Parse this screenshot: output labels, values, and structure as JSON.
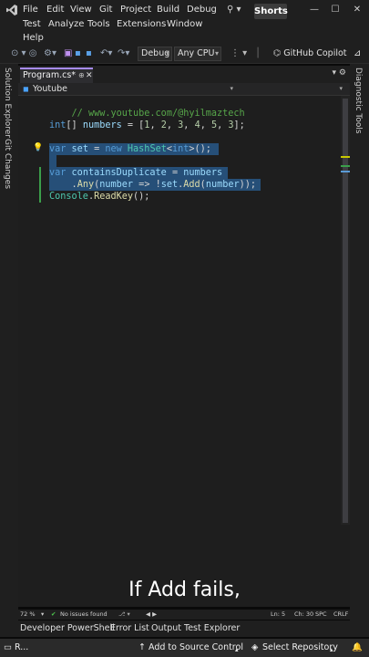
{
  "menubar": {
    "row1": [
      "File",
      "Edit",
      "View",
      "Git",
      "Project",
      "Build",
      "Debug"
    ],
    "row2": [
      "Test",
      "Analyze",
      "Tools",
      "Extensions",
      "Window"
    ],
    "row3": [
      "Help"
    ],
    "search_icon": "search-icon",
    "shorts_label": "Shorts"
  },
  "toolbar": {
    "config": "Debug",
    "platform": "Any CPU",
    "copilot_label": "GitHub Copilot"
  },
  "left_rail": {
    "solution_explorer": "Solution Explorer",
    "git_changes": "Git Changes"
  },
  "right_rail": {
    "diagnostic_tools": "Diagnostic Tools"
  },
  "tabs": {
    "active_label": "Program.cs*"
  },
  "navbar": {
    "project": "Youtube"
  },
  "code": {
    "line1": "// www.youtube.com/@hyilmaztech",
    "line2_kw": "int",
    "line2_a": "[] ",
    "line2_var": "numbers",
    "line2_b": " = [",
    "line2_n1": "1",
    "line2_n2": "2",
    "line2_n3": "3",
    "line2_n4": "4",
    "line2_n5": "5",
    "line2_n6": "3",
    "line2_end": "];",
    "line3_var": "var",
    "line3_name": "set",
    "line3_eq": " = ",
    "line3_new": "new",
    "line3_type": "HashSet",
    "line3_gen_open": "<",
    "line3_int": "int",
    "line3_gen_close": ">();",
    "line4_var": "var",
    "line4_name": "containsDuplicate",
    "line4_eq": " = ",
    "line4_src": "numbers",
    "line5_dot": ".",
    "line5_any": "Any",
    "line5_p": "(",
    "line5_arg": "number",
    "line5_arrow": " => !",
    "line5_set": "set",
    "line5_dot2": ".",
    "line5_add": "Add",
    "line5_p2": "(",
    "line5_arg2": "number",
    "line5_end": "));",
    "line6_cls": "Console",
    "line6_dot": ".",
    "line6_meth": "ReadKey",
    "line6_end": "();"
  },
  "caption": "If Add fails,",
  "status_row": {
    "zoom": "72 %",
    "issues": "No issues found",
    "ln": "Ln: 5",
    "ch": "Ch: 30",
    "spc": "SPC",
    "crlf": "CRLF"
  },
  "bottom_tabs": [
    "Developer PowerShell",
    "Error List",
    "Output",
    "Test Explorer"
  ],
  "statusbar": {
    "ready": "R...",
    "source_control": "Add to Source Control",
    "repository": "Select Repository"
  },
  "colors": {
    "accent": "#a78bfa",
    "selection": "#264f78",
    "keyword": "#569cd6",
    "comment": "#57a64a",
    "type": "#4ec9b0"
  }
}
